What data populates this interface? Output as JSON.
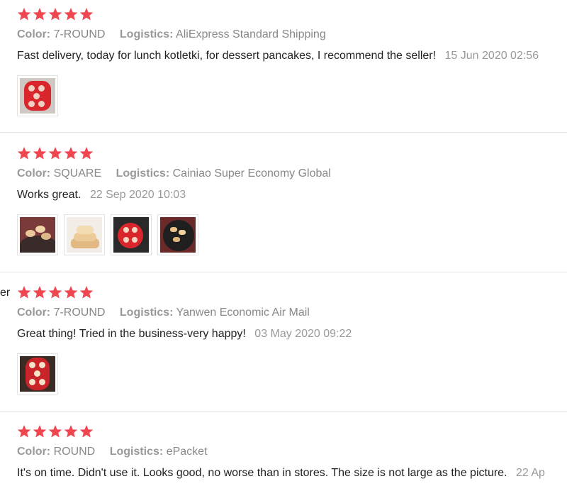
{
  "colors": {
    "star": "#f0464f",
    "accent": "#e53935"
  },
  "labels": {
    "color": "Color:",
    "logistics": "Logistics:"
  },
  "edge_fragment": "er",
  "reviews": [
    {
      "stars": 5,
      "color_value": "7-ROUND",
      "logistics_value": "AliExpress Standard Shipping",
      "text": "Fast delivery, today for lunch kotletki, for dessert pancakes, I recommend the seller!",
      "date": "15 Jun 2020 02:56",
      "photos": [
        "red-silicone-mold-photo"
      ]
    },
    {
      "stars": 5,
      "color_value": "SQUARE",
      "logistics_value": "Cainiao Super Economy Global",
      "text": "Works great.",
      "date": "22 Sep 2020 10:03",
      "photos": [
        "pancakes-on-plate-photo",
        "stacked-pancakes-photo",
        "mold-in-pan-photo",
        "food-on-dark-plate-photo"
      ]
    },
    {
      "stars": 5,
      "color_value": "7-ROUND",
      "logistics_value": "Yanwen Economic Air Mail",
      "text": "Great thing! Tried in the business-very happy!",
      "date": "03 May 2020 09:22",
      "photos": [
        "mold-with-batter-photo"
      ]
    },
    {
      "stars": 5,
      "color_value": "ROUND",
      "logistics_value": "ePacket",
      "text": "It's on time. Didn't use it. Looks good, no worse than in stores. The size is not large as the picture.",
      "date": "22 Ap",
      "photos": []
    }
  ]
}
